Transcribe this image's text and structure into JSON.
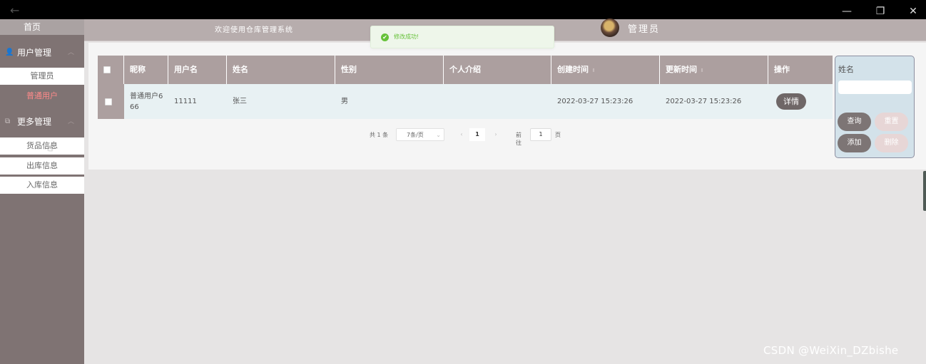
{
  "window": {
    "back_icon": "←",
    "minimize_icon": "—",
    "restore_icon": "❐",
    "close_icon": "✕"
  },
  "sidebar": {
    "home": "首页",
    "groups": [
      {
        "label": "用户管理",
        "icon": "👤",
        "items": [
          {
            "label": "管理员",
            "active": false
          },
          {
            "label": "普通用户",
            "active": true
          }
        ]
      },
      {
        "label": "更多管理",
        "icon": "⧉",
        "items": [
          {
            "label": "货品信息"
          },
          {
            "label": "出库信息"
          },
          {
            "label": "入库信息"
          }
        ]
      }
    ],
    "chevron": "︿"
  },
  "header": {
    "welcome": "欢迎使用仓库管理系统",
    "admin_name": "管理员"
  },
  "toast": {
    "message": "修改成功!",
    "icon": "✔"
  },
  "table": {
    "columns": [
      "昵称",
      "用户名",
      "姓名",
      "性别",
      "个人介绍",
      "创建时间",
      "更新时间",
      "操作"
    ],
    "sort_icon": "⇕",
    "rows": [
      {
        "nickname": "普通用户666",
        "nickname_line1": "普通用户6",
        "nickname_line2": "66",
        "username": "11111",
        "name": "张三",
        "gender": "男",
        "intro": "",
        "created": "2022-03-27 15:23:26",
        "updated": "2022-03-27 15:23:26",
        "action": "详情"
      }
    ]
  },
  "pagination": {
    "total": "共 1 条",
    "page_size": "7条/页",
    "current_page": "1",
    "goto_prefix": "前往",
    "goto_value": "1",
    "goto_suffix": "页",
    "prev_icon": "‹",
    "next_icon": "›",
    "caret": "⌄"
  },
  "search": {
    "label": "姓名",
    "value": "",
    "query_btn": "查询",
    "reset_btn": "重置",
    "add_btn": "添加",
    "delete_btn": "删除"
  },
  "watermark": "CSDN @WeiXin_DZbishe"
}
